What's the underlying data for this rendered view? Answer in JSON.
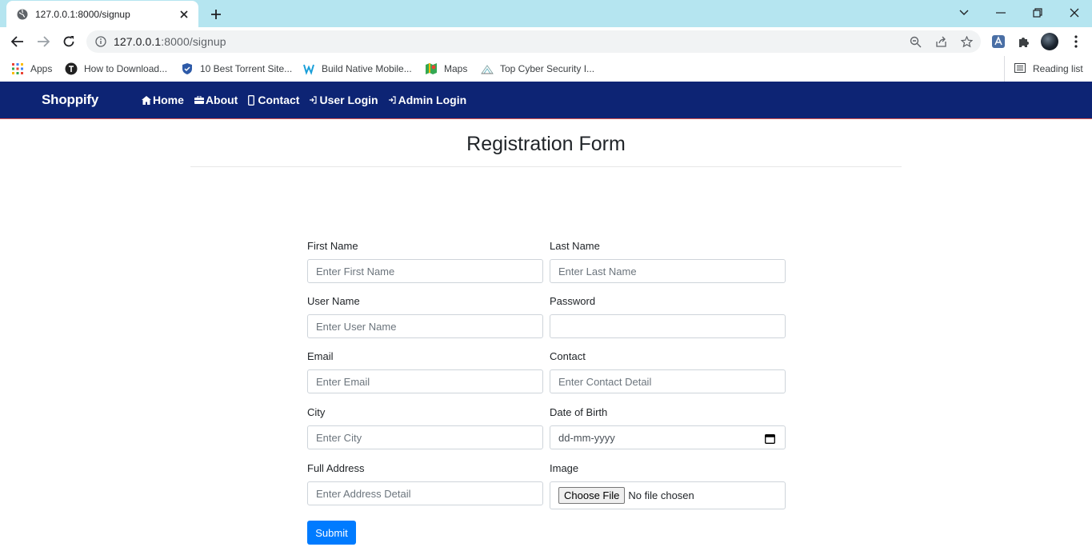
{
  "browser": {
    "tab_title": "127.0.0.1:8000/signup",
    "url_host": "127.0.0.1",
    "url_rest": ":8000/signup",
    "bookmarks": [
      {
        "label": "Apps",
        "icon": "apps-grid-icon"
      },
      {
        "label": "How to Download...",
        "icon": "download-site-icon"
      },
      {
        "label": "10 Best Torrent Site...",
        "icon": "shield-icon"
      },
      {
        "label": "Build Native Mobile...",
        "icon": "build-app-icon"
      },
      {
        "label": "Maps",
        "icon": "maps-icon"
      },
      {
        "label": "Top Cyber Security I...",
        "icon": "cyber-security-icon"
      }
    ],
    "reading_list": "Reading list"
  },
  "site": {
    "brand": "Shoppify",
    "nav": [
      {
        "label": "Home",
        "icon": "home-icon"
      },
      {
        "label": "About",
        "icon": "briefcase-icon"
      },
      {
        "label": "Contact",
        "icon": "phone-icon"
      },
      {
        "label": "User Login",
        "icon": "login-icon"
      },
      {
        "label": "Admin Login",
        "icon": "login-icon"
      }
    ],
    "accent": "#0d2474"
  },
  "form": {
    "title": "Registration Form",
    "fields": {
      "first_name": {
        "label": "First Name",
        "placeholder": "Enter First Name"
      },
      "last_name": {
        "label": "Last Name",
        "placeholder": "Enter Last Name"
      },
      "user_name": {
        "label": "User Name",
        "placeholder": "Enter User Name"
      },
      "password": {
        "label": "Password",
        "placeholder": ""
      },
      "email": {
        "label": "Email",
        "placeholder": "Enter Email"
      },
      "contact": {
        "label": "Contact",
        "placeholder": "Enter Contact Detail"
      },
      "city": {
        "label": "City",
        "placeholder": "Enter City"
      },
      "dob": {
        "label": "Date of Birth",
        "placeholder": "dd-mm-yyyy"
      },
      "address": {
        "label": "Full Address",
        "placeholder": "Enter Address Detail"
      },
      "image": {
        "label": "Image",
        "button": "Choose File",
        "status": "No file chosen"
      }
    },
    "submit": "Submit",
    "submit_color": "#007bff"
  }
}
